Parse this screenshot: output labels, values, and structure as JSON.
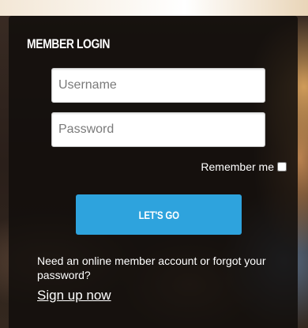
{
  "login": {
    "title": "MEMBER LOGIN",
    "username_placeholder": "Username",
    "password_placeholder": "Password",
    "remember_label": "Remember me",
    "submit_label": "LET'S GO",
    "help_text": "Need an online member account or forgot your password?",
    "signup_link": "Sign up now"
  },
  "colors": {
    "button": "#2ea3dd",
    "panel": "#120e0c",
    "text": "#ffffff"
  }
}
